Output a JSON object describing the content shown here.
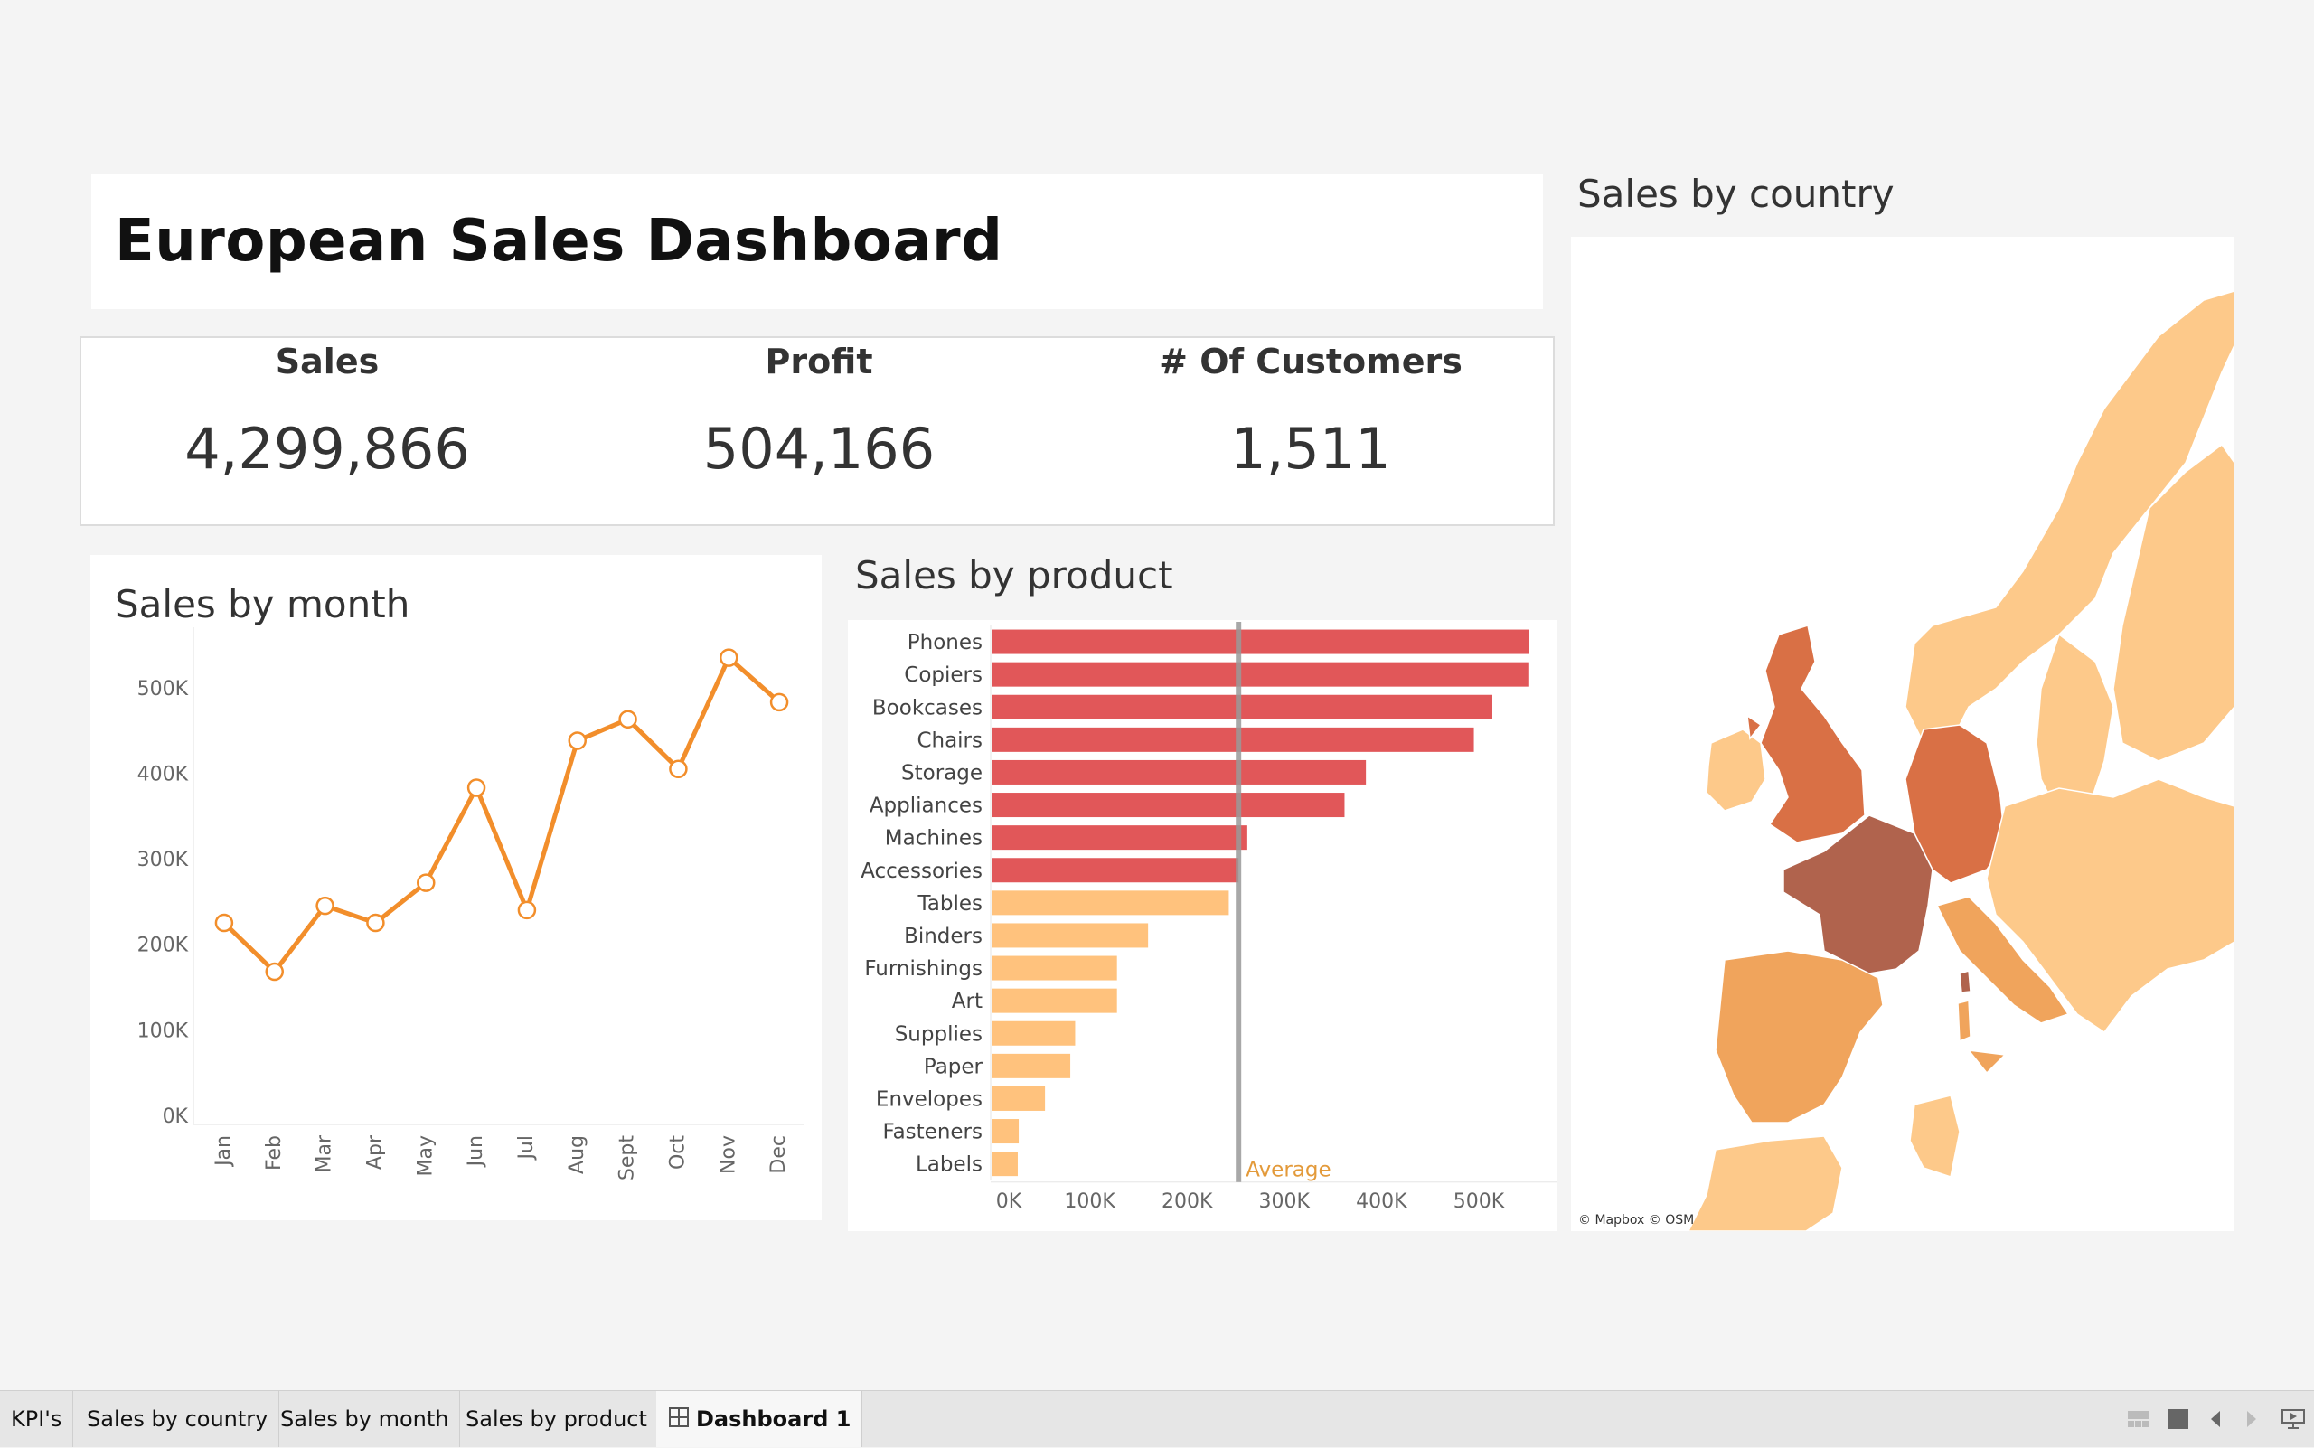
{
  "dashboard": {
    "title": "European Sales Dashboard"
  },
  "kpis": [
    {
      "label": "Sales",
      "value": "4,299,866"
    },
    {
      "label": "Profit",
      "value": "504,166"
    },
    {
      "label": "# Of Customers",
      "value": "1,511"
    }
  ],
  "month_chart": {
    "title": "Sales by month"
  },
  "product_chart": {
    "title": "Sales by product",
    "average_label": "Average"
  },
  "map": {
    "title": "Sales by country",
    "attribution": "© Mapbox © OSM"
  },
  "tabs": [
    {
      "label": "KPI's",
      "active": false
    },
    {
      "label": "Sales by country",
      "active": false
    },
    {
      "label": "Sales by month",
      "active": false
    },
    {
      "label": "Sales by product",
      "active": false
    },
    {
      "label": "Dashboard 1",
      "active": true,
      "icon": "grid-icon"
    }
  ],
  "colors": {
    "line": "#f28e2b",
    "bar_above_avg": "#e15759",
    "bar_below_avg": "#ffc27d",
    "average_line": "#999999",
    "average_label": "#e39a3a",
    "map_france": "#b0634d",
    "map_high": "#d97045",
    "map_mid": "#f0a45c",
    "map_low": "#fdc98a"
  },
  "chart_data": [
    {
      "type": "line",
      "title": "Sales by month",
      "categories": [
        "Jan",
        "Feb",
        "Mar",
        "Apr",
        "May",
        "Jun",
        "Jul",
        "Aug",
        "Sept",
        "Oct",
        "Nov",
        "Dec"
      ],
      "values": [
        225000,
        168000,
        245000,
        225000,
        272000,
        383000,
        240000,
        438000,
        463000,
        405000,
        535000,
        483000
      ],
      "y_ticks": [
        "0K",
        "100K",
        "200K",
        "300K",
        "400K",
        "500K"
      ],
      "ylim": [
        0,
        560000
      ],
      "grid": false
    },
    {
      "type": "bar",
      "orientation": "horizontal",
      "title": "Sales by product",
      "categories": [
        "Phones",
        "Copiers",
        "Bookcases",
        "Chairs",
        "Storage",
        "Appliances",
        "Machines",
        "Accessories",
        "Tables",
        "Binders",
        "Furnishings",
        "Art",
        "Supplies",
        "Paper",
        "Envelopes",
        "Fasteners",
        "Labels"
      ],
      "values": [
        552000,
        551000,
        514000,
        495000,
        384000,
        362000,
        262000,
        253000,
        243000,
        160000,
        128000,
        128000,
        85000,
        80000,
        54000,
        27000,
        26000
      ],
      "average": 253000,
      "x_ticks": [
        "0K",
        "100K",
        "200K",
        "300K",
        "400K",
        "500K"
      ],
      "xlim": [
        0,
        580000
      ]
    }
  ]
}
